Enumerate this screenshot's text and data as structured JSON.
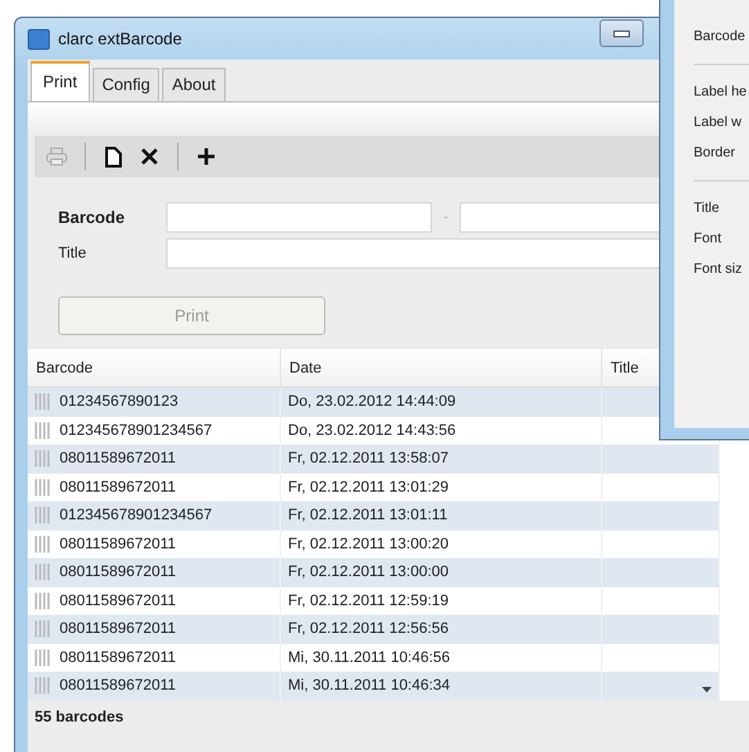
{
  "window": {
    "title": "clarc extBarcode"
  },
  "tabs": [
    {
      "label": "Print",
      "selected": true
    },
    {
      "label": "Config",
      "selected": false
    },
    {
      "label": "About",
      "selected": false
    }
  ],
  "toolbar": [
    {
      "kind": "print",
      "disabled": true
    },
    {
      "kind": "sep"
    },
    {
      "kind": "new",
      "disabled": false
    },
    {
      "kind": "delete",
      "disabled": false
    },
    {
      "kind": "sep"
    },
    {
      "kind": "add",
      "disabled": false
    }
  ],
  "form": {
    "barcode_label": "Barcode",
    "title_label": "Title",
    "separator": "-",
    "print_button": {
      "label": "Print",
      "disabled": true
    }
  },
  "table": {
    "columns": [
      "Barcode",
      "Date",
      "Title"
    ],
    "rows": [
      {
        "barcode": "01234567890123",
        "date": "Do, 23.02.2012 14:44:09"
      },
      {
        "barcode": "012345678901234567",
        "date": "Do, 23.02.2012 14:43:56"
      },
      {
        "barcode": "08011589672011",
        "date": "Fr, 02.12.2011 13:58:07"
      },
      {
        "barcode": "08011589672011",
        "date": "Fr, 02.12.2011 13:01:29"
      },
      {
        "barcode": "012345678901234567",
        "date": "Fr, 02.12.2011 13:01:11"
      },
      {
        "barcode": "08011589672011",
        "date": "Fr, 02.12.2011 13:00:20"
      },
      {
        "barcode": "08011589672011",
        "date": "Fr, 02.12.2011 13:00:00"
      },
      {
        "barcode": "08011589672011",
        "date": "Fr, 02.12.2011 12:59:19"
      },
      {
        "barcode": "08011589672011",
        "date": "Fr, 02.12.2011 12:56:56"
      },
      {
        "barcode": "08011589672011",
        "date": "Mi, 30.11.2011 10:46:56"
      },
      {
        "barcode": "08011589672011",
        "date": "Mi, 30.11.2011 10:46:34"
      }
    ]
  },
  "status_bar": "55 barcodes",
  "side_window": {
    "groups": [
      [
        "Barcode"
      ],
      [
        "Label he",
        "Label w",
        "Border"
      ],
      [
        "Title",
        "Font",
        "Font siz"
      ]
    ]
  }
}
